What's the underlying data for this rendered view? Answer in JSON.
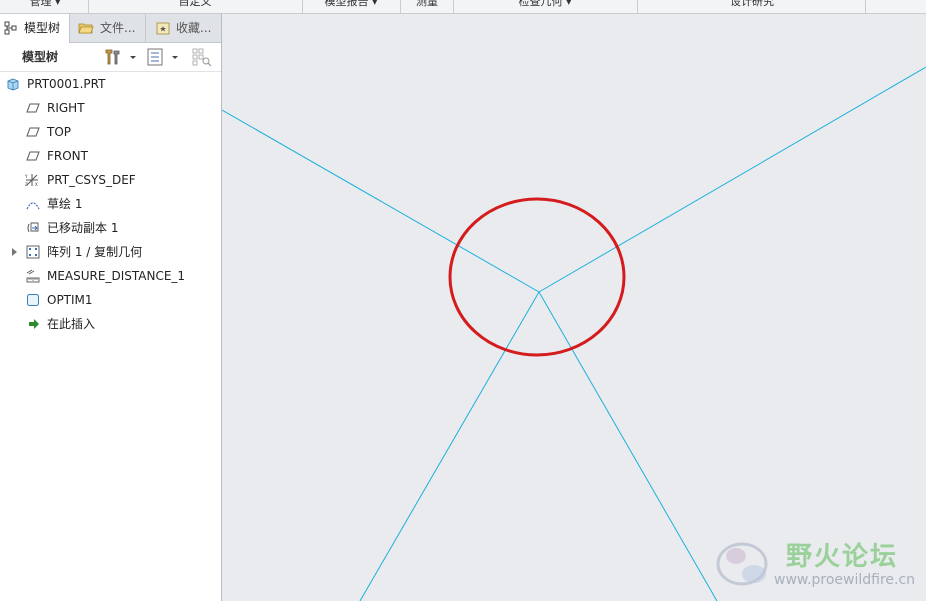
{
  "ribbon": {
    "groups": [
      "管理 ▾",
      "自定义",
      "模型报告 ▾",
      "测量",
      "检查几何 ▾",
      "设计研究"
    ]
  },
  "panel": {
    "tabs": [
      {
        "label": "模型树",
        "icon": "model-tree-icon",
        "active": true
      },
      {
        "label": "文件...",
        "icon": "folder-icon",
        "active": false
      },
      {
        "label": "收藏...",
        "icon": "favorites-icon",
        "active": false
      }
    ],
    "toolbar_title": "模型树"
  },
  "tree": {
    "items": [
      {
        "label": "PRT0001.PRT",
        "icon": "part-icon"
      },
      {
        "label": "RIGHT",
        "icon": "datum-plane-icon"
      },
      {
        "label": "TOP",
        "icon": "datum-plane-icon"
      },
      {
        "label": "FRONT",
        "icon": "datum-plane-icon"
      },
      {
        "label": "PRT_CSYS_DEF",
        "icon": "csys-icon"
      },
      {
        "label": "草绘 1",
        "icon": "sketch-icon"
      },
      {
        "label": "已移动副本 1",
        "icon": "moved-copy-icon"
      },
      {
        "label": "阵列 1 / 复制几何",
        "icon": "pattern-icon"
      },
      {
        "label": "MEASURE_DISTANCE_1",
        "icon": "measure-icon"
      },
      {
        "label": "OPTIM1",
        "icon": "optimize-icon"
      },
      {
        "label": "在此插入",
        "icon": "insert-here-arrow-icon"
      }
    ]
  },
  "colors": {
    "sketch_line": "#1bb1de",
    "highlight_circle": "#d41c1c",
    "viewport_bg": "#eaebee"
  },
  "watermark": {
    "title": "野火论坛",
    "url": "www.proewildfire.cn"
  }
}
